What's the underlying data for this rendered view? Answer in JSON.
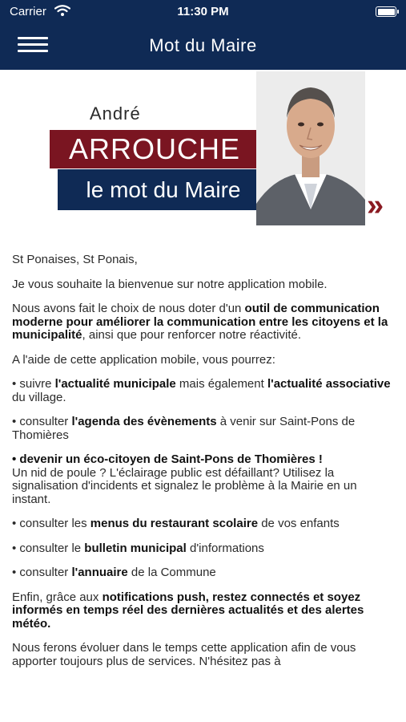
{
  "status_bar": {
    "carrier": "Carrier",
    "time": "11:30 PM"
  },
  "nav": {
    "title": "Mot du Maire"
  },
  "banner": {
    "first_name": "André",
    "last_name": "ARROUCHE",
    "subtitle": "le mot du Maire",
    "arrow": "»"
  },
  "body": {
    "greeting": "St Ponaises, St Ponais,",
    "welcome": "Je vous souhaite la bienvenue sur notre application mobile.",
    "p1_a": "Nous avons fait le choix de nous doter d'un ",
    "p1_b": "outil de communication moderne pour améliorer la communication entre les citoyens et la municipalité",
    "p1_c": ", ainsi que pour renforcer notre réactivité.",
    "p2": "A l'aide de cette application mobile, vous pourrez:",
    "b1_a": "• suivre ",
    "b1_b": "l'actualité municipale",
    "b1_c": " mais également ",
    "b1_d": "l'actualité associative",
    "b1_e": " du village.",
    "b2_a": "• consulter ",
    "b2_b": "l'agenda des évènements",
    "b2_c": " à venir sur Saint-Pons de Thomières",
    "b3_a": "• devenir un éco-citoyen de Saint-Pons de Thomières !",
    "b3_b": "Un nid de poule ? L'éclairage public est défaillant? Utilisez la signalisation d'incidents et signalez le problème à la Mairie en un instant.",
    "b4_a": "• consulter les ",
    "b4_b": "menus du restaurant scolaire",
    "b4_c": " de vos enfants",
    "b5_a": "• consulter le ",
    "b5_b": "bulletin municipal",
    "b5_c": " d'informations",
    "b6_a": "• consulter ",
    "b6_b": "l'annuaire",
    "b6_c": " de la Commune",
    "p3_a": "Enfin, grâce aux ",
    "p3_b": "notifications push, restez connectés et soyez informés en temps réel des dernières actualités et des alertes météo.",
    "p4": "Nous ferons évoluer dans le temps cette application afin de vous apporter toujours plus de services. N'hésitez pas à"
  }
}
